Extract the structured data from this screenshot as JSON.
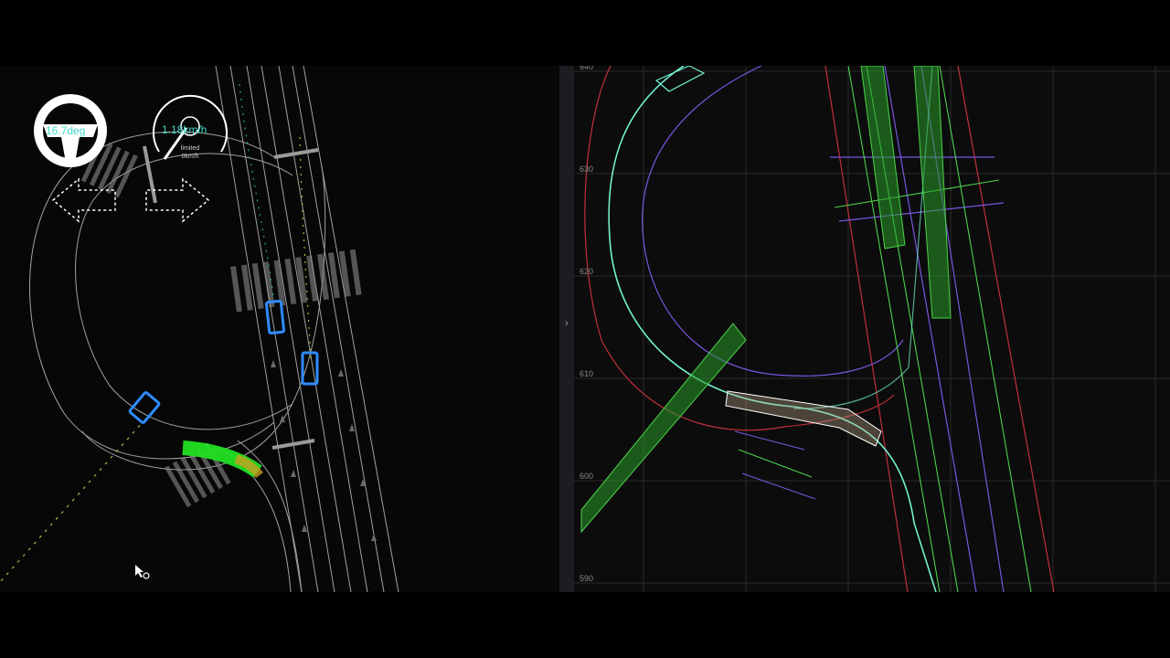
{
  "hud": {
    "steering_angle": "16.7deg",
    "speed": "1.18km/h",
    "speed_limit_label": "limited",
    "speed_limit_value": "0km/h",
    "left_turn_signal_icon": "arrow-left-outline",
    "right_turn_signal_icon": "arrow-right-outline",
    "steering_wheel_icon": "steering-wheel"
  },
  "plot": {
    "y_ticks": [
      "640",
      "630",
      "620",
      "610",
      "600",
      "590"
    ]
  },
  "divider": {
    "collapse_glyph": "›"
  },
  "colors": {
    "hud_text": "#41d9c8",
    "ego_path": "#22e022",
    "obstacle": "#2f8bff",
    "lane_center": "#2fa0a0",
    "plot_red": "#c0303a",
    "plot_purple": "#7a55e0",
    "plot_green": "#4bd24b",
    "plot_cyan": "#72f0d0"
  }
}
